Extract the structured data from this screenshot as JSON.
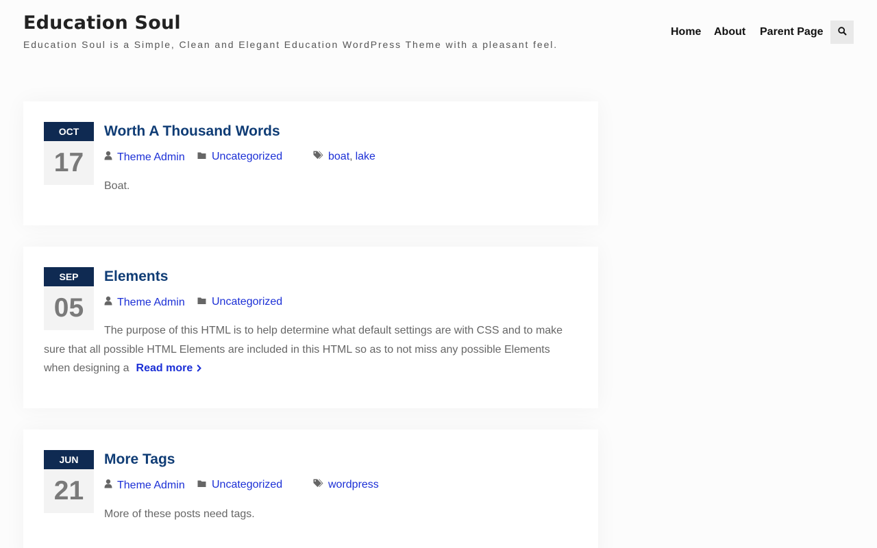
{
  "site": {
    "title": "Education Soul",
    "description": "Education Soul is a Simple, Clean and Elegant Education WordPress Theme with a pleasant feel."
  },
  "nav": {
    "home": "Home",
    "about": "About",
    "parent_page": "Parent Page",
    "search_icon": "search-icon"
  },
  "posts": [
    {
      "month": "OCT",
      "day": "17",
      "title": "Worth A Thousand Words",
      "author": "Theme Admin",
      "category": "Uncategorized",
      "tags": [
        "boat",
        "lake"
      ],
      "excerpt": "Boat."
    },
    {
      "month": "SEP",
      "day": "05",
      "title": "Elements",
      "author": "Theme Admin",
      "category": "Uncategorized",
      "tags": [],
      "excerpt": "The purpose of this HTML is to help determine what default settings are with CSS and to make sure that all possible HTML Elements are included in this HTML so as to not miss any possible Elements when designing a",
      "read_more": "Read more"
    },
    {
      "month": "JUN",
      "day": "21",
      "title": "More Tags",
      "author": "Theme Admin",
      "category": "Uncategorized",
      "tags": [
        "wordpress"
      ],
      "excerpt": "More of these posts need tags."
    }
  ],
  "colors": {
    "title": "#0f3c75",
    "link": "#1b2fd6",
    "date_month_bg": "#0f2a52",
    "date_day_bg": "#f3f3f3"
  }
}
